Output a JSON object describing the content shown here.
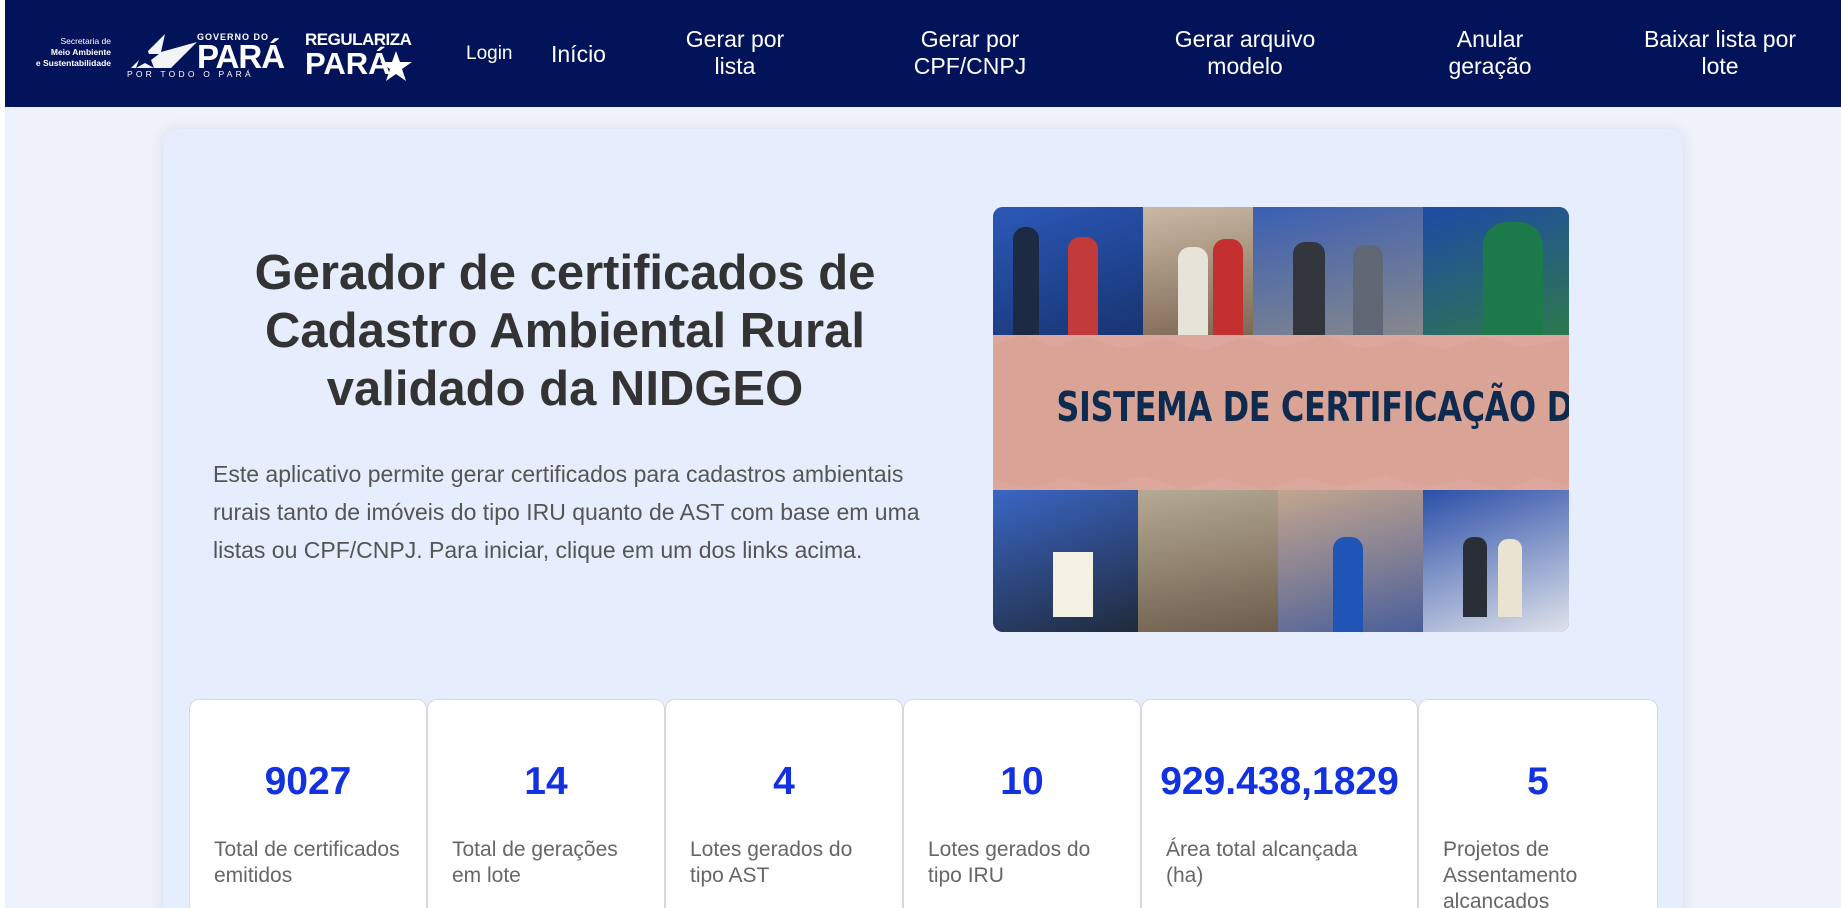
{
  "logos": {
    "semas": [
      "Secretaria de",
      "Meio Ambiente",
      "e Sustentabilidade"
    ],
    "governo_do": "GOVERNO DO",
    "para": "PARÁ",
    "para_tagline": "POR TODO O PARÁ",
    "regulariza": "REGULARIZA",
    "regulariza_para": "PARÁ"
  },
  "nav": {
    "login": "Login",
    "inicio": "Início",
    "gerar_lista": "Gerar por lista",
    "gerar_cpf": "Gerar por CPF/CNPJ",
    "gerar_modelo": "Gerar arquivo modelo",
    "anular": "Anular geração",
    "baixar_lote": "Baixar lista por lote"
  },
  "hero": {
    "title": "Gerador de certificados de Cadastro Ambiental Rural validado da NIDGEO",
    "description": "Este aplicativo permite gerar certificados para cadastros ambientais rurais tanto de imóveis do tipo IRU quanto de AST com base em uma listas ou CPF/CNPJ. Para iniciar, clique em um dos links acima.",
    "image_title": "SISTEMA DE CERTIFICAÇÃO DE CAR"
  },
  "stats": [
    {
      "value": "9027",
      "label": "Total de certificados emitidos"
    },
    {
      "value": "14",
      "label": "Total de gerações em lote"
    },
    {
      "value": "4",
      "label": "Lotes gerados do tipo AST"
    },
    {
      "value": "10",
      "label": "Lotes gerados do tipo IRU"
    },
    {
      "value": "929.438,1829",
      "label": "Área total alcançada (ha)"
    },
    {
      "value": "5",
      "label": "Projetos de Assentamento alcançados"
    }
  ],
  "colors": {
    "navbar": "#03135a",
    "accent": "#1231e0",
    "card_bg": "#e6edfc",
    "page_bg": "#eef2fb",
    "torn_paper": "#dca79c"
  }
}
